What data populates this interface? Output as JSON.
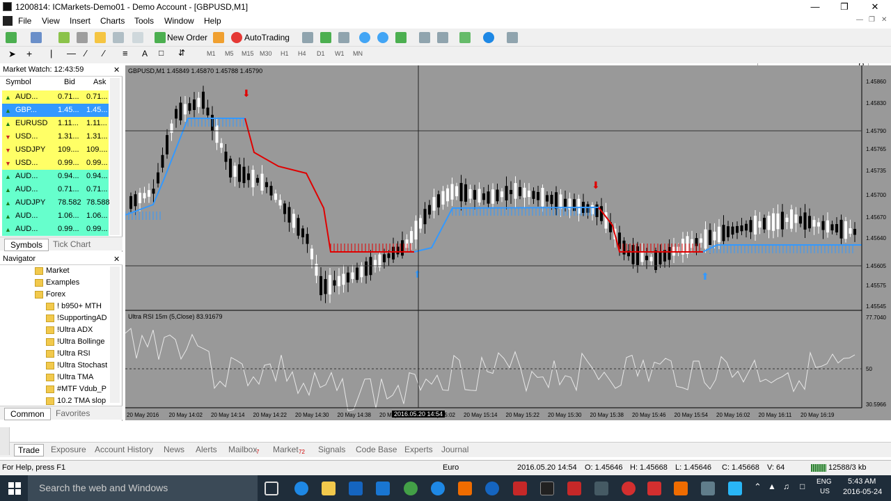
{
  "window": {
    "title": "1200814: ICMarkets-Demo01 - Demo Account - [GBPUSD,M1]"
  },
  "menu": [
    "File",
    "View",
    "Insert",
    "Charts",
    "Tools",
    "Window",
    "Help"
  ],
  "toolbar": {
    "new_order": "New Order",
    "autotrading": "AutoTrading"
  },
  "timeframes": [
    "M1",
    "M5",
    "M15",
    "M30",
    "H1",
    "H4",
    "D1",
    "W1",
    "MN"
  ],
  "market_watch": {
    "title": "Market Watch: 12:43:59",
    "headers": {
      "symbol": "Symbol",
      "bid": "Bid",
      "ask": "Ask"
    },
    "rows": [
      {
        "symbol": "AUD...",
        "bid": "0.71...",
        "ask": "0.71...",
        "bg": "#ffff66",
        "dir": "up"
      },
      {
        "symbol": "GBP...",
        "bid": "1.45...",
        "ask": "1.45...",
        "bg": "#3399ff",
        "dir": "up"
      },
      {
        "symbol": "EURUSD",
        "bid": "1.11...",
        "ask": "1.11...",
        "bg": "#ffff66",
        "dir": "up"
      },
      {
        "symbol": "USD...",
        "bid": "1.31...",
        "ask": "1.31...",
        "bg": "#ffff66",
        "dir": "down"
      },
      {
        "symbol": "USDJPY",
        "bid": "109....",
        "ask": "109....",
        "bg": "#ffff66",
        "dir": "down"
      },
      {
        "symbol": "USD...",
        "bid": "0.99...",
        "ask": "0.99...",
        "bg": "#ffff66",
        "dir": "down"
      },
      {
        "symbol": "AUD...",
        "bid": "0.94...",
        "ask": "0.94...",
        "bg": "#66ffcc",
        "dir": "up"
      },
      {
        "symbol": "AUD...",
        "bid": "0.71...",
        "ask": "0.71...",
        "bg": "#66ffcc",
        "dir": "up"
      },
      {
        "symbol": "AUDJPY",
        "bid": "78.582",
        "ask": "78.588",
        "bg": "#66ffcc",
        "dir": "up"
      },
      {
        "symbol": "AUD...",
        "bid": "1.06...",
        "ask": "1.06...",
        "bg": "#66ffcc",
        "dir": "up"
      },
      {
        "symbol": "AUD...",
        "bid": "0.99...",
        "ask": "0.99...",
        "bg": "#66ffcc",
        "dir": "up"
      }
    ],
    "tabs": [
      "Symbols",
      "Tick Chart"
    ]
  },
  "navigator": {
    "title": "Navigator",
    "items": [
      "Market",
      "Examples",
      "Forex",
      "!  b950+ MTH",
      "!SupportingAD",
      "!Ultra ADX",
      "!Ultra Bollinge",
      "!Ultra RSI",
      "!Ultra Stochast",
      "!Ultra TMA",
      "#MTF Vdub_P",
      "10.2 TMA slop"
    ],
    "tabs": [
      "Common",
      "Favorites"
    ]
  },
  "chart": {
    "header": "GBPUSD,M1  1.45849 1.45870 1.45788 1.45790",
    "indicator_label": "Ultra RSI 15m (5,Close) 83.91679",
    "price_labels": [
      "1.45860",
      "1.45830",
      "1.45790",
      "1.45765",
      "1.45735",
      "1.45700",
      "1.45670",
      "1.45640",
      "1.45605",
      "1.45575",
      "1.45545"
    ],
    "rsi_labels": [
      "77.7040",
      "50",
      "30.5966"
    ],
    "time_labels": [
      "20 May 2016",
      "20 May 14:02",
      "20 May 14:14",
      "20 May 14:22",
      "20 May 14:30",
      "20 May 14:38",
      "20 May 14:54",
      "20 May 15:02",
      "20 May 15:14",
      "20 May 15:22",
      "20 May 15:30",
      "20 May 15:38",
      "20 May 15:46",
      "20 May 15:54",
      "20 May 16:02",
      "20 May 16:11",
      "20 May 16:19"
    ],
    "crosshair_time": "2016.05.20 14:54",
    "colors": {
      "bg": "#999999",
      "up_line": "#3399ff",
      "down_line": "#e00000",
      "rsi": "#e8e8e8"
    }
  },
  "terminal_tabs": [
    "Trade",
    "Exposure",
    "Account History",
    "News",
    "Alerts",
    "Mailbox",
    "Market",
    "Signals",
    "Code Base",
    "Experts",
    "Journal"
  ],
  "terminal_badges": {
    "mailbox": "7",
    "market": "72"
  },
  "status": {
    "help": "For Help, press F1",
    "profile": "Euro",
    "datetime": "2016.05.20 14:54",
    "open": "O: 1.45646",
    "high": "H: 1.45668",
    "low": "L: 1.45646",
    "close": "C: 1.45668",
    "volume": "V: 64",
    "traffic": "12588/3 kb"
  },
  "taskbar": {
    "search": "Search the web and Windows",
    "lang1": "ENG",
    "lang2": "US",
    "time": "5:43 AM",
    "date": "2016-05-24"
  }
}
